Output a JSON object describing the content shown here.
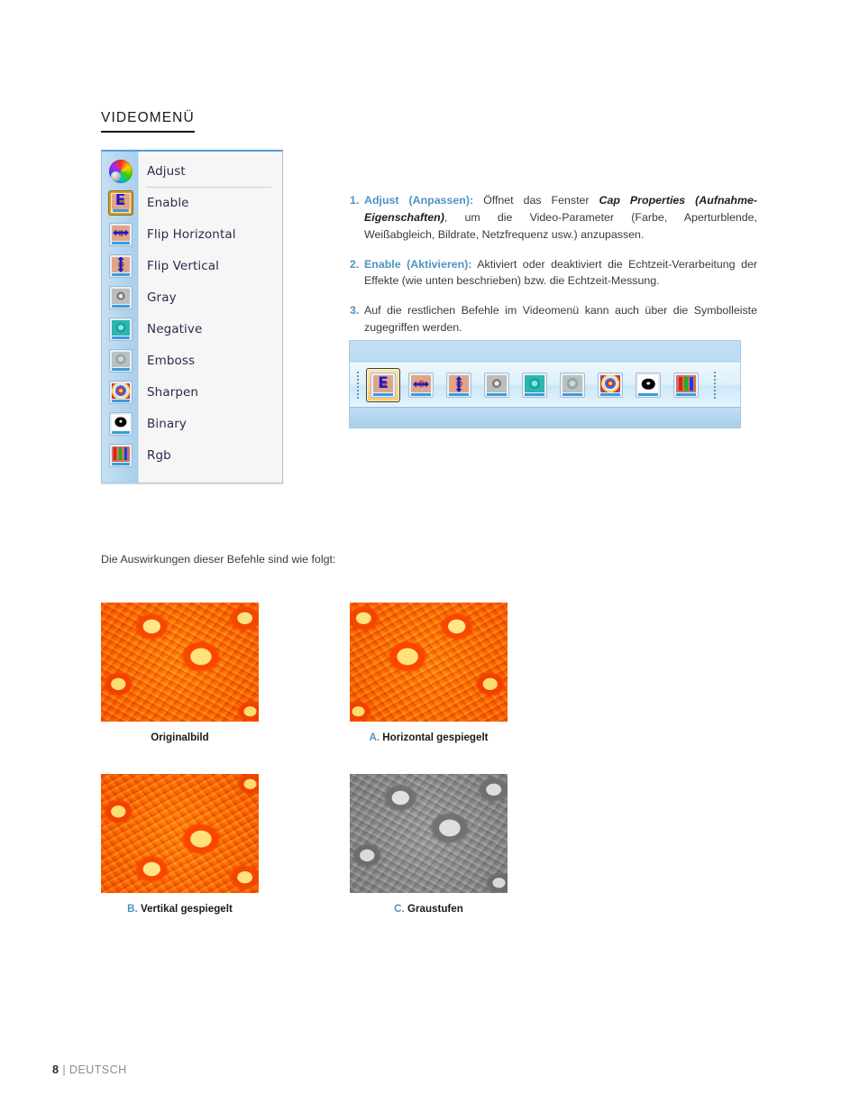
{
  "heading": "VIDEOMENÜ",
  "menu": {
    "items": [
      {
        "label": "Adjust",
        "icon": "color-wheel-icon",
        "selected": false
      },
      {
        "label": "Enable",
        "icon": "enable-e-icon",
        "selected": true
      },
      {
        "label": "Flip Horizontal",
        "icon": "flip-horizontal-icon",
        "selected": false
      },
      {
        "label": "Flip Vertical",
        "icon": "flip-vertical-icon",
        "selected": false
      },
      {
        "label": "Gray",
        "icon": "gray-icon",
        "selected": false
      },
      {
        "label": "Negative",
        "icon": "negative-icon",
        "selected": false
      },
      {
        "label": "Emboss",
        "icon": "emboss-icon",
        "selected": false
      },
      {
        "label": "Sharpen",
        "icon": "sharpen-icon",
        "selected": false
      },
      {
        "label": "Binary",
        "icon": "binary-icon",
        "selected": false
      },
      {
        "label": "Rgb",
        "icon": "rgb-icon",
        "selected": false
      }
    ]
  },
  "notes": [
    {
      "num": "1.",
      "term": "Adjust (Anpassen):",
      "text_before": " Öffnet das Fenster ",
      "emphasis": "Cap Properties (Aufnahme-Eigenschaften)",
      "text_after": ", um die Video-Parameter (Farbe, Aperturblende, Weißabgleich, Bildrate, Netzfrequenz usw.) anzupassen."
    },
    {
      "num": "2.",
      "term": "Enable (Aktivieren):",
      "text_before": " Aktiviert oder deaktiviert die Echtzeit-Verarbeitung der Effekte (wie unten beschrieben) bzw. die Echtzeit-Messung.",
      "emphasis": "",
      "text_after": ""
    },
    {
      "num": "3.",
      "term": "",
      "text_before": "Auf die restlichen Befehle im Videomenü kann auch über die Symbolleiste zugegriffen werden.",
      "emphasis": "",
      "text_after": ""
    }
  ],
  "toolbar": {
    "buttons": [
      {
        "icon": "enable-e-icon",
        "active": true
      },
      {
        "icon": "flip-horizontal-icon",
        "active": false
      },
      {
        "icon": "flip-vertical-icon",
        "active": false
      },
      {
        "icon": "gray-icon",
        "active": false
      },
      {
        "icon": "negative-icon",
        "active": false
      },
      {
        "icon": "emboss-icon",
        "active": false
      },
      {
        "icon": "sharpen-icon",
        "active": false
      },
      {
        "icon": "binary-icon",
        "active": false
      },
      {
        "icon": "rgb-icon",
        "active": false
      }
    ]
  },
  "intro_line": "Die Auswirkungen dieser Befehle sind wie folgt:",
  "figures": [
    {
      "letter": "",
      "caption": "Originalbild",
      "effect": "original"
    },
    {
      "letter": "A.",
      "caption": "Horizontal gespiegelt",
      "effect": "flip-h"
    },
    {
      "letter": "B.",
      "caption": "Vertikal gespiegelt",
      "effect": "flip-v"
    },
    {
      "letter": "C.",
      "caption": "Graustufen",
      "effect": "grayscale"
    }
  ],
  "footer": {
    "page": "8",
    "separator": "|",
    "language": "DEUTSCH"
  },
  "colors": {
    "accent_blue": "#4d93c4",
    "heading": "#1a1a1a",
    "body_text": "#3a3a3a",
    "selected_highlight": "#ffc970"
  }
}
